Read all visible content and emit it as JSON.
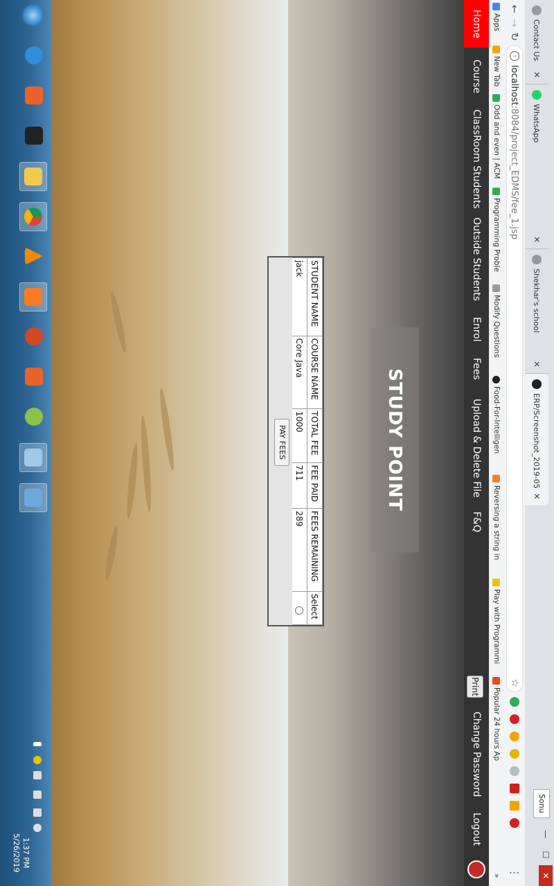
{
  "browser": {
    "tabs": [
      {
        "label": "Contact Us",
        "icon": "page-icon",
        "color": "#888888"
      },
      {
        "label": "WhatsApp",
        "icon": "whatsapp-icon",
        "color": "#25d366"
      },
      {
        "label": "Shekhar's school",
        "icon": "page-icon",
        "color": "#888888"
      },
      {
        "label": "ERP/Screenshot_2019-05",
        "icon": "github-icon",
        "color": "#222222"
      }
    ],
    "profile_name": "Sonu",
    "url_host": "localhost",
    "url_path": ":8084/project_EDMS/fee_1.jsp",
    "bookmarks": [
      {
        "label": "Apps",
        "icon": "apps-grid-icon",
        "color": "#4285f4"
      },
      {
        "label": "New Tab",
        "icon": "bookmark-icon",
        "color": "#f2a400"
      },
      {
        "label": "Odd and even | ACM",
        "icon": "hackerearth-icon",
        "color": "#2fab5e"
      },
      {
        "label": "Programming Proble",
        "icon": "hackerearth-icon",
        "color": "#2fab5e"
      },
      {
        "label": "Modify Questions",
        "icon": "page-icon",
        "color": "#888888"
      },
      {
        "label": "Food-For-Intelligen",
        "icon": "github-icon",
        "color": "#222222"
      },
      {
        "label": "Reversing a string in",
        "icon": "stackoverflow-icon",
        "color": "#f48024"
      },
      {
        "label": "Play with Programmi",
        "icon": "bookmark-icon",
        "color": "#f2c400"
      },
      {
        "label": "Popular 24 hours Ap",
        "icon": "x-icon",
        "color": "#e8491d"
      }
    ],
    "overflow_label": "»"
  },
  "nav": {
    "home": "Home",
    "items": [
      "Course",
      "ClassRoom Students",
      "Outside Students",
      "Enrol",
      "Fees",
      "Upload & Delete File",
      "F&Q"
    ],
    "print": "Print",
    "change_password": "Change Password",
    "logout": "Logout"
  },
  "page": {
    "title": "STUDY POINT"
  },
  "fee_table": {
    "headers": [
      "STUDENT NAME",
      "COURSE NAME",
      "TOTAL FEE",
      "FEE PAID",
      "FEES REMAINING",
      "Select"
    ],
    "rows": [
      [
        "jack",
        "Core Java",
        "1000",
        "711",
        "289"
      ]
    ],
    "pay_button": "PAY FEES"
  },
  "taskbar": {
    "time": "1:37 PM",
    "date": "5/26/2019",
    "colors": {
      "accent": "#2f6795",
      "nav_home": "#ff0000",
      "nav_bar": "#333333"
    }
  }
}
